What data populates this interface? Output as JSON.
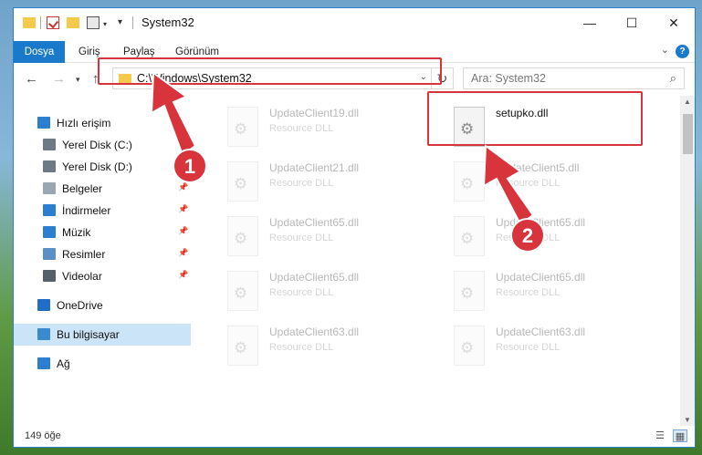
{
  "window": {
    "title": "System32",
    "controls": {
      "minimize": "—",
      "maximize": "☐",
      "close": "✕"
    }
  },
  "ribbon": {
    "tabs": [
      {
        "label": "Dosya",
        "active": true
      },
      {
        "label": "Giriş"
      },
      {
        "label": "Paylaş"
      },
      {
        "label": "Görünüm"
      }
    ],
    "help": "?"
  },
  "navigation": {
    "address": "C:\\Windows\\System32",
    "search_placeholder": "Ara: System32"
  },
  "sidebar": {
    "items": [
      {
        "label": "Hızlı erişim",
        "icon": "star-icon",
        "color": "#2b7fd1"
      },
      {
        "label": "Yerel Disk (C:)",
        "icon": "drive-icon",
        "color": "#6d7a86",
        "pinned": true
      },
      {
        "label": "Yerel Disk (D:)",
        "icon": "drive-icon",
        "color": "#6d7a86"
      },
      {
        "label": "Belgeler",
        "icon": "documents-icon",
        "color": "#9aa6b2",
        "pinned": true
      },
      {
        "label": "İndirmeler",
        "icon": "downloads-icon",
        "color": "#2b7fd1",
        "pinned": true
      },
      {
        "label": "Müzik",
        "icon": "music-icon",
        "color": "#2b7fd1",
        "pinned": true
      },
      {
        "label": "Resimler",
        "icon": "pictures-icon",
        "color": "#5b8fc7",
        "pinned": true
      },
      {
        "label": "Videolar",
        "icon": "videos-icon",
        "color": "#55606b",
        "pinned": true
      },
      {
        "label": "OneDrive",
        "icon": "cloud-icon",
        "color": "#1e6ec8"
      },
      {
        "label": "Bu bilgisayar",
        "icon": "computer-icon",
        "color": "#3b8ad0",
        "selected": true
      },
      {
        "label": "Ağ",
        "icon": "network-icon",
        "color": "#2b7fd1"
      }
    ]
  },
  "files": [
    {
      "name": "UpdateClient19.dll",
      "type": "Resource DLL",
      "faded": true
    },
    {
      "name": "setupko.dll",
      "type": "",
      "faded": false
    },
    {
      "name": "UpdateClient21.dll",
      "type": "Resource DLL",
      "faded": true
    },
    {
      "name": "UpdateClient5.dll",
      "type": "Resource DLL",
      "faded": true
    },
    {
      "name": "UpdateClient65.dll",
      "type": "Resource DLL",
      "faded": true
    },
    {
      "name": "UpdateClient65.dll",
      "type": "Resource DLL",
      "faded": true
    },
    {
      "name": "UpdateClient65.dll",
      "type": "Resource DLL",
      "faded": true
    },
    {
      "name": "UpdateClient65.dll",
      "type": "Resource DLL",
      "faded": true
    },
    {
      "name": "UpdateClient63.dll",
      "type": "Resource DLL",
      "faded": true
    },
    {
      "name": "UpdateClient63.dll",
      "type": "Resource DLL",
      "faded": true
    }
  ],
  "status": {
    "item_count": "149 öğe"
  },
  "annotations": {
    "badges": [
      "1",
      "2"
    ],
    "color": "#d7343b"
  }
}
